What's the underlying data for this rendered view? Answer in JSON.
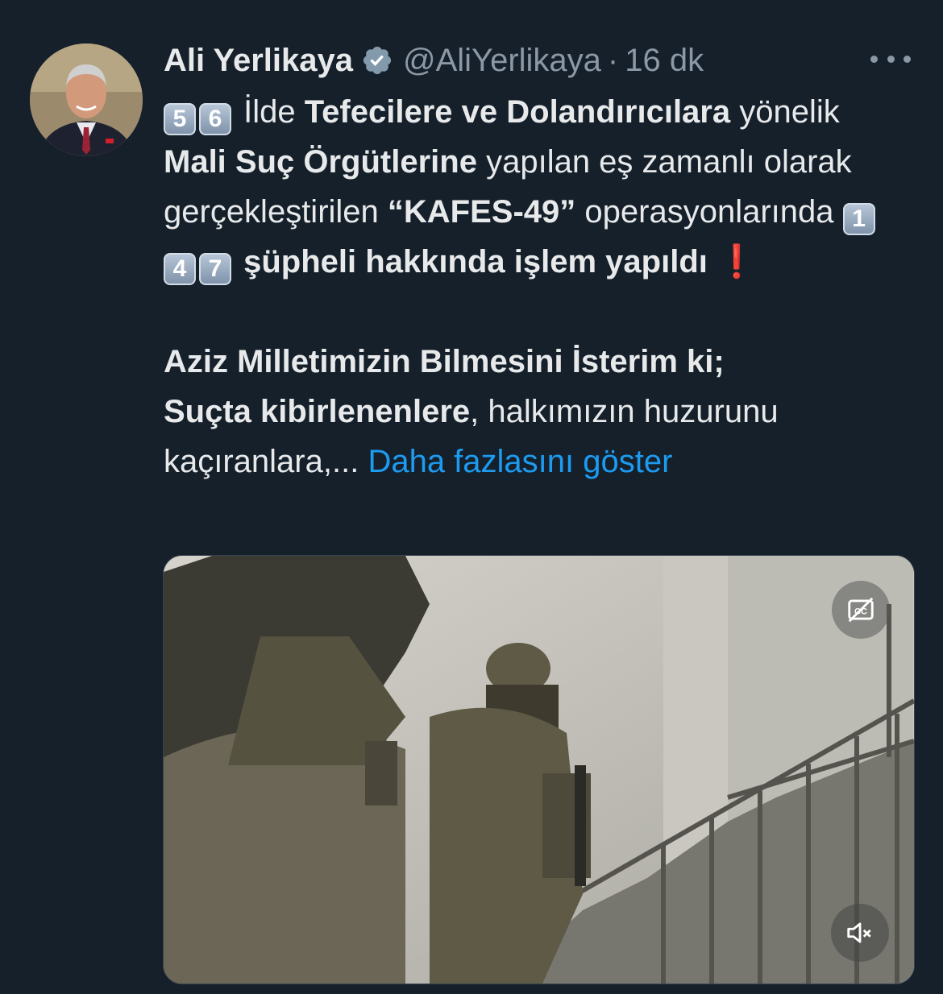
{
  "tweet": {
    "author": {
      "name": "Ali Yerlikaya",
      "handle": "@AliYerlikaya",
      "separator": "·",
      "time": "16 dk"
    },
    "keycaps_intro": [
      "5",
      "6"
    ],
    "t1": " İlde ",
    "b1": "Tefecilere ve Dolandırıcılara",
    "t2": " yönelik ",
    "b2": "Mali Suç Örgütlerine",
    "t3": " yapılan eş zamanlı olarak gerçekleştirilen ",
    "b3": "“KAFES-49”",
    "t4": " operasyonlarında ",
    "keycaps_count": [
      "1",
      "4",
      "7"
    ],
    "b4": "şüpheli hakkında işlem yapıldı",
    "exclamation": "❗",
    "p2_bold1": "Aziz Milletimizin Bilmesini İsterim ki;",
    "p2_bold2": "Suçta kibirlenenlere",
    "p2_text": ", halkımızın huzurunu kaçıranlara,... ",
    "show_more": "Daha fazlasını göster"
  },
  "media": {
    "type": "video",
    "captions_icon": "closed-captions-off-icon",
    "mute_icon": "volume-muted-icon"
  },
  "colors": {
    "background": "#15202b",
    "link": "#1d9bf0",
    "secondary_text": "#8b98a5",
    "verified_badge": "#829aab"
  }
}
